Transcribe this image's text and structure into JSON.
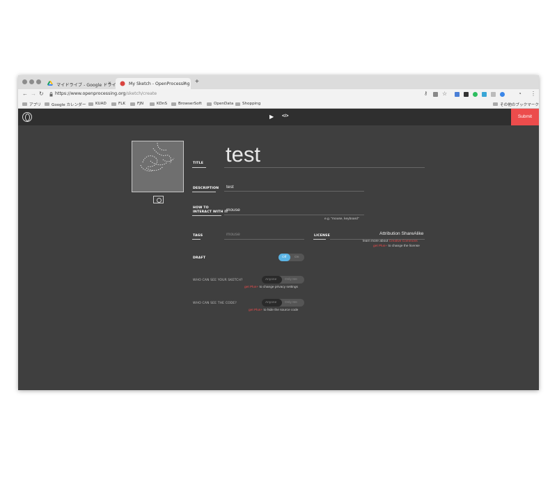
{
  "browser": {
    "tabs": [
      {
        "title": "マイドライブ - Google ドライブ",
        "close": "×"
      },
      {
        "title": "My Sketch - OpenProcessing",
        "close": "×"
      }
    ],
    "new_tab": "+",
    "url_host": "https://www.openprocessing.org",
    "url_path": "/sketch/create",
    "bookmarks": [
      "アプリ",
      "Google カレンダー",
      "KUAD",
      "FLK",
      "FJN",
      "KDnS",
      "BrowserSoft",
      "OpenData",
      "Shopping"
    ],
    "other_bookmarks": "その他のブックマーク"
  },
  "app": {
    "submit_label": "Submit",
    "play_icon": "▶",
    "code_icon": "</>"
  },
  "form": {
    "title_label": "TITLE",
    "title_value": "test",
    "description_label": "DESCRIPTION",
    "description_value": "test",
    "interact_label_1": "HOW TO",
    "interact_label_2": "INTERACT WITH IT",
    "interact_value": "mouse",
    "interact_hint": "e.g. \"mouse, keyboard\"",
    "tags_label": "TAGS",
    "tags_placeholder": "mouse",
    "license_label": "LICENSE",
    "license_value": "Attribution ShareAlike",
    "license_hint_1": "learn more about",
    "license_hint_link": "Creative Commons",
    "license_hint_2_link": "get Plus+",
    "license_hint_2": "to change the license",
    "draft_label": "DRAFT",
    "draft_off": "Off",
    "draft_on": "On",
    "who_see_sketch_label": "WHO CAN SEE YOUR SKETCH?",
    "who_see_code_label": "WHO CAN SEE THE CODE?",
    "opt_anyone": "Anyone",
    "opt_only_me": "Only Me",
    "privacy_hint_link": "get Plus+",
    "privacy_hint": "to change privacy settings",
    "code_hint_link": "get Plus+",
    "code_hint": "to hide the source code"
  },
  "colors": {
    "accent_red": "#ec4c4c",
    "toggle_blue": "#5bb4e5",
    "background": "#3f3f3f"
  }
}
